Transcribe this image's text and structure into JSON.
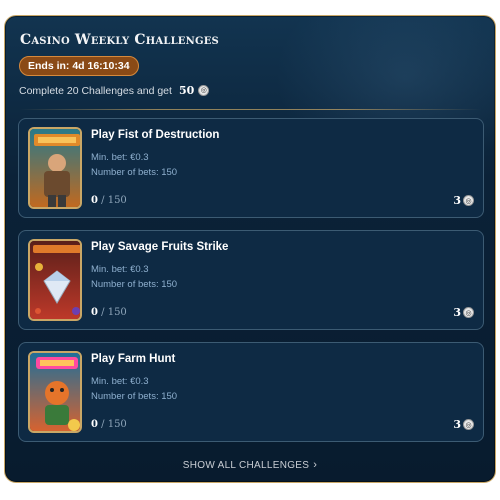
{
  "header": {
    "title": "Casino Weekly Challenges",
    "timer": "Ends in: 4d 16:10:34",
    "subtitle": "Complete 20 Challenges and get",
    "reward": "50",
    "reward_icon": "coin-icon"
  },
  "challenges": [
    {
      "title": "Play Fist of Destruction",
      "min_bet": "Min. bet: €0.3",
      "bets": "Number of bets: 150",
      "current": "0",
      "total": "/ 150",
      "reward": "3",
      "thumb_colors": [
        "#2a7a8a",
        "#c8681a"
      ]
    },
    {
      "title": "Play Savage Fruits Strike",
      "min_bet": "Min. bet: €0.3",
      "bets": "Number of bets: 150",
      "current": "0",
      "total": "/ 150",
      "reward": "3",
      "thumb_colors": [
        "#5a1f1a",
        "#c23a2a"
      ]
    },
    {
      "title": "Play Farm Hunt",
      "min_bet": "Min. bet: €0.3",
      "bets": "Number of bets: 150",
      "current": "0",
      "total": "/ 150",
      "reward": "3",
      "thumb_colors": [
        "#1f6f9a",
        "#e0622a"
      ]
    }
  ],
  "footer": {
    "show_all": "SHOW ALL CHALLENGES",
    "chevron_icon": "chevron-right-icon"
  },
  "colors": {
    "accent_gold": "#c9a766",
    "timer_bg": "#8a4a16",
    "card_bg": "#0e2a44"
  }
}
